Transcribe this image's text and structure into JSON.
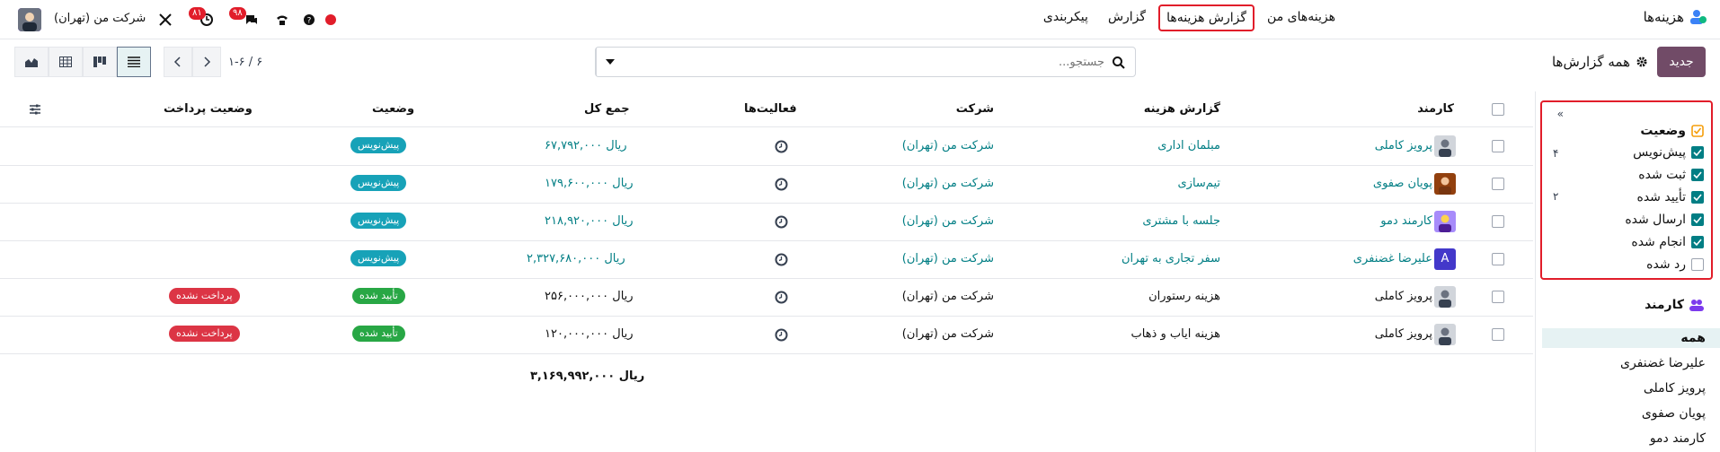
{
  "topbar": {
    "app_name": "هزینه‌ها",
    "menu": [
      {
        "label": "هزینه‌های من",
        "active": false
      },
      {
        "label": "گزارش هزینه‌ها",
        "active": true
      },
      {
        "label": "گزارش",
        "active": false
      },
      {
        "label": "پیکربندی",
        "active": false
      }
    ],
    "company": "شرکت من (تهران)",
    "badge_activity": "۸۱",
    "badge_messages": "۹۸"
  },
  "control": {
    "new_label": "جدید",
    "breadcrumb": "همه گزارش‌ها",
    "search_placeholder": "جستجو...",
    "pager": "۱-۶ / ۶"
  },
  "filters": {
    "title": "وضعیت",
    "items": [
      {
        "label": "پیش‌نویس",
        "checked": true,
        "count": "۴"
      },
      {
        "label": "ثبت شده",
        "checked": true,
        "count": ""
      },
      {
        "label": "تأیید شده",
        "checked": true,
        "count": "۲"
      },
      {
        "label": "ارسال شده",
        "checked": true,
        "count": ""
      },
      {
        "label": "انجام شده",
        "checked": true,
        "count": ""
      },
      {
        "label": "رد شده",
        "checked": false,
        "count": ""
      }
    ]
  },
  "employees": {
    "title": "کارمند",
    "items": [
      "همه",
      "علیرضا غضنفری",
      "پرویز کاملی",
      "پویان صفوی",
      "کارمند دمو"
    ]
  },
  "table": {
    "headers": {
      "employee": "کارمند",
      "report": "گزارش هزینه",
      "company": "شرکت",
      "activities": "فعالیت‌ها",
      "total": "جمع کل",
      "status": "وضعیت",
      "payment": "وضعیت پرداخت"
    },
    "rows": [
      {
        "employee": "پرویز کاملی",
        "report": "مبلمان اداری",
        "company": "شرکت من (تهران)",
        "total": "۶۷,۷۹۲,۰۰۰ ریال",
        "status": "پیش‌نویس",
        "payment": "",
        "linked": true
      },
      {
        "employee": "پویان صفوی",
        "report": "تیم‌سازی",
        "company": "شرکت من (تهران)",
        "total": "۱۷۹,۶۰۰,۰۰۰ ریال",
        "status": "پیش‌نویس",
        "payment": "",
        "linked": true
      },
      {
        "employee": "کارمند دمو",
        "report": "جلسه با مشتری",
        "company": "شرکت من (تهران)",
        "total": "۲۱۸,۹۲۰,۰۰۰ ریال",
        "status": "پیش‌نویس",
        "payment": "",
        "linked": true
      },
      {
        "employee": "علیرضا غضنفری",
        "report": "سفر تجاری به تهران",
        "company": "شرکت من (تهران)",
        "total": "۲,۳۲۷,۶۸۰,۰۰۰ ریال",
        "status": "پیش‌نویس",
        "payment": "",
        "linked": true
      },
      {
        "employee": "پرویز کاملی",
        "report": "هزینه رستوران",
        "company": "شرکت من (تهران)",
        "total": "۲۵۶,۰۰۰,۰۰۰ ریال",
        "status": "تأیید شده",
        "payment": "پرداخت نشده",
        "linked": false
      },
      {
        "employee": "پرویز کاملی",
        "report": "هزینه ایاب و ذهاب",
        "company": "شرکت من (تهران)",
        "total": "۱۲۰,۰۰۰,۰۰۰ ریال",
        "status": "تأیید شده",
        "payment": "پرداخت نشده",
        "linked": false
      }
    ],
    "grand_total": "۳,۱۶۹,۹۹۲,۰۰۰ ریال"
  },
  "colors": {
    "accent": "#714b67",
    "link": "#017e84",
    "highlight": "#e11d2a"
  }
}
